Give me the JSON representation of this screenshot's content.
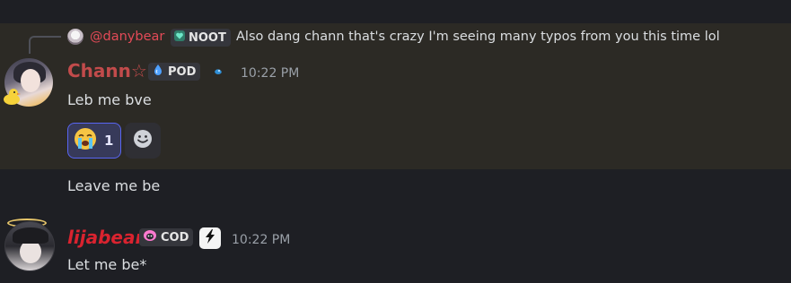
{
  "reply": {
    "username": "@danybear",
    "tag": {
      "icon": "heart-icon",
      "label": "NOOT",
      "icon_color": "#6ee7c8"
    },
    "text": "Also dang chann that's crazy I'm seeing many typos from you this time lol"
  },
  "messages": [
    {
      "username": "Chann☆",
      "name_color": "#c24b4b",
      "tag": {
        "icon": "water-drop-icon",
        "label": "POD",
        "icon_color": "#4ea0ff"
      },
      "timestamp": "10:22 PM",
      "text": "Leb me bve",
      "highlighted": true,
      "reaction": {
        "emoji": "😭",
        "count": "1"
      }
    },
    {
      "continuation": true,
      "text": "Leave me be"
    },
    {
      "username": "lijabear",
      "name_color": "#d9232f",
      "tag": {
        "icon": "mushroom-icon",
        "label": "COD",
        "icon_color": "#ff7ad0"
      },
      "timestamp": "10:22 PM",
      "text": "Let me be*"
    }
  ]
}
